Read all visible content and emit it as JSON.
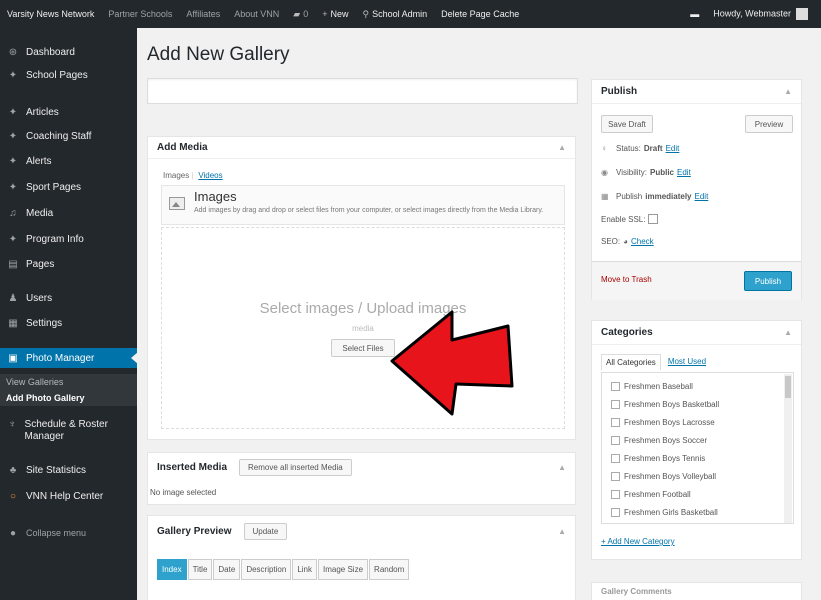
{
  "adminbar": {
    "site_name": "Varsity News Network",
    "items": [
      "Partner Schools",
      "Affiliates",
      "About VNN"
    ],
    "comments_count": "0",
    "new_label": "New",
    "school_admin_label": "School Admin",
    "delete_cache_label": "Delete Page Cache",
    "howdy_label": "Howdy, Webmaster"
  },
  "sidebar": {
    "items": [
      {
        "label": "Dashboard",
        "icon": "dashboard-icon",
        "glyph": "⊛"
      },
      {
        "label": "School Pages",
        "icon": "pin-icon",
        "glyph": "✦"
      },
      {
        "label": "Articles",
        "icon": "pin-icon",
        "glyph": "✦"
      },
      {
        "label": "Coaching Staff",
        "icon": "pin-icon",
        "glyph": "✦"
      },
      {
        "label": "Alerts",
        "icon": "pin-icon",
        "glyph": "✦"
      },
      {
        "label": "Sport Pages",
        "icon": "pin-icon",
        "glyph": "✦"
      },
      {
        "label": "Media",
        "icon": "media-icon",
        "glyph": "♫"
      },
      {
        "label": "Program Info",
        "icon": "pin-icon",
        "glyph": "✦"
      },
      {
        "label": "Pages",
        "icon": "pages-icon",
        "glyph": "▤"
      },
      {
        "label": "Users",
        "icon": "users-icon",
        "glyph": "♟"
      },
      {
        "label": "Settings",
        "icon": "settings-icon",
        "glyph": "▦"
      },
      {
        "label": "Photo Manager",
        "icon": "photo-manager-icon",
        "glyph": "▣"
      }
    ],
    "submenu": [
      "View Galleries",
      "Add Photo Gallery"
    ],
    "schedule_label": "Schedule & Roster Manager",
    "statistics_label": "Site Statistics",
    "help_label": "VNN Help Center",
    "collapse_label": "Collapse menu"
  },
  "main": {
    "page_title": "Add New Gallery",
    "title_value": ""
  },
  "add_media": {
    "title": "Add Media",
    "tabs": [
      "Images",
      "Videos"
    ],
    "heading": "Images",
    "description": "Add images by drag and drop or select files from your computer, or select images directly from the Media Library.",
    "drop_title": "Select images / Upload images",
    "drop_or": "media",
    "select_files_label": "Select Files"
  },
  "inserted_media": {
    "title": "Inserted Media",
    "remove_label": "Remove all inserted Media",
    "note": "No image selected"
  },
  "gallery_preview": {
    "title": "Gallery Preview",
    "update_label": "Update",
    "tabs": [
      "Index",
      "Title",
      "Date",
      "Description",
      "Link",
      "Image Size",
      "Random"
    ]
  },
  "publish": {
    "title": "Publish",
    "save_draft_label": "Save Draft",
    "preview_label": "Preview",
    "status_label": "Status:",
    "status_value": "Draft",
    "visibility_label": "Visibility:",
    "visibility_value": "Public",
    "publish_label": "Publish",
    "publish_value": "immediately",
    "edit_label": "Edit",
    "ssl_label": "Enable SSL:",
    "seo_label": "SEO:",
    "seo_check_label": "Check",
    "trash_label": "Move to Trash",
    "publish_button_label": "Publish"
  },
  "categories": {
    "title": "Categories",
    "tab_all": "All Categories",
    "tab_most_used": "Most Used",
    "items": [
      "Freshmen Baseball",
      "Freshmen Boys Basketball",
      "Freshmen Boys Lacrosse",
      "Freshmen Boys Soccer",
      "Freshmen Boys Tennis",
      "Freshmen Boys Volleyball",
      "Freshmen Football",
      "Freshmen Girls Basketball"
    ],
    "add_new_label": "+ Add New Category"
  },
  "gallery_comments": {
    "title": "Gallery Comments"
  },
  "colors": {
    "admin_dark": "#23282d",
    "accent_blue": "#0073aa",
    "publish_blue": "#2ea2cc",
    "arrow_red": "#e8141b"
  }
}
